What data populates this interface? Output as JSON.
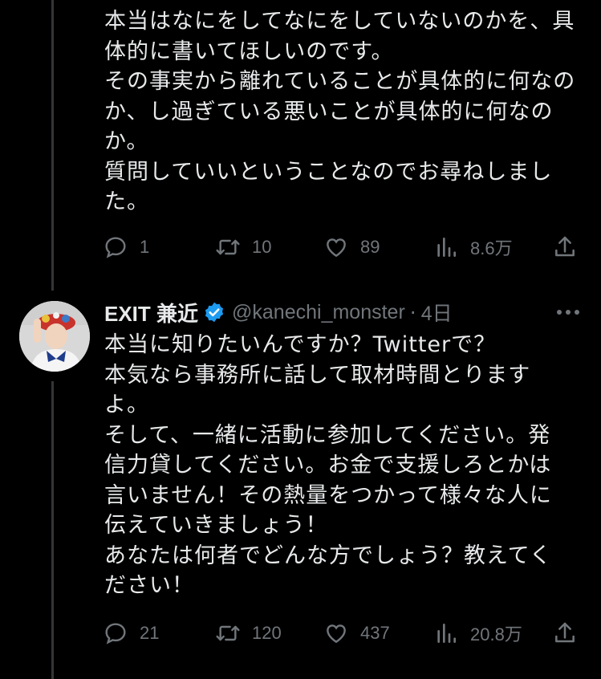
{
  "parent_tweet": {
    "lines": [
      "本当はなにをしてなにをしていないのかを、具",
      "体的に書いてほしいのです。",
      "その事実から離れていることが具体的に何なの",
      "か、し過ぎている悪いことが具体的に何なの",
      "か。",
      "質問していいということなのでお尋ねしまし",
      "た。"
    ],
    "stats": {
      "replies": "1",
      "retweets": "10",
      "likes": "89",
      "views": "8.6万"
    }
  },
  "reply_tweet": {
    "author_name": "EXIT 兼近",
    "verified": true,
    "handle": "@kanechi_monster",
    "separator": "·",
    "time": "4日",
    "lines": [
      "本当に知りたいんですか？Twitterで？",
      "本気なら事務所に話して取材時間とります",
      "よ。",
      "そして、一緒に活動に参加してください。発",
      "信力貸してください。お金で支援しろとかは",
      "言いません！その熱量をつかって様々な人に",
      "伝えていきましょう！",
      "あなたは何者でどんな方でしょう？教えてく",
      "ださい！"
    ],
    "stats": {
      "replies": "21",
      "retweets": "120",
      "likes": "437",
      "views": "20.8万"
    }
  },
  "icons": {
    "reply": "reply-icon",
    "retweet": "retweet-icon",
    "like": "heart-icon",
    "views": "views-icon",
    "share": "share-icon",
    "more": "more-icon",
    "verified": "verified-badge-icon"
  },
  "colors": {
    "background": "#000000",
    "text": "#e7e9ea",
    "muted": "#71767b",
    "verified": "#1d9bf0"
  }
}
